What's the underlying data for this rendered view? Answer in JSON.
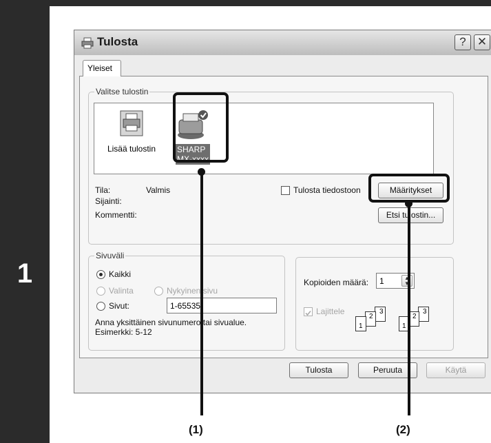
{
  "step": {
    "number": "1"
  },
  "dialog": {
    "title": "Tulosta",
    "help_glyph": "?",
    "close_glyph": "✕",
    "tab": "Yleiset",
    "printer_group": {
      "legend": "Valitse tulostin",
      "items": [
        {
          "label": "Lisää tulostin",
          "icon": "add-printer-icon"
        },
        {
          "label_line1": "SHARP",
          "label_line2": "MX-xxxx",
          "icon": "printer-default-icon"
        }
      ],
      "status_label": "Tila:",
      "status_value": "Valmis",
      "location_label": "Sijainti:",
      "comment_label": "Kommentti:",
      "print_to_file_label": "Tulosta tiedostoon",
      "preferences_button": "Määritykset",
      "find_printer_button": "Etsi tulostin..."
    },
    "page_range": {
      "legend": "Sivuväli",
      "all": "Kaikki",
      "selection": "Valinta",
      "current_page": "Nykyinen sivu",
      "pages": "Sivut:",
      "pages_value": "1-65535",
      "hint_line1": "Anna yksittäinen sivunumero tai sivualue.",
      "hint_line2": "Esimerkki: 5-12"
    },
    "copies": {
      "label": "Kopioiden määrä:",
      "value": "1",
      "collate_label": "Lajittele",
      "collate_set1": [
        "1",
        "2",
        "3"
      ],
      "collate_set2": [
        "1",
        "2",
        "3"
      ]
    },
    "buttons": {
      "print": "Tulosta",
      "cancel": "Peruuta",
      "apply": "Käytä"
    }
  },
  "callouts": {
    "one": "(1)",
    "two": "(2)"
  }
}
